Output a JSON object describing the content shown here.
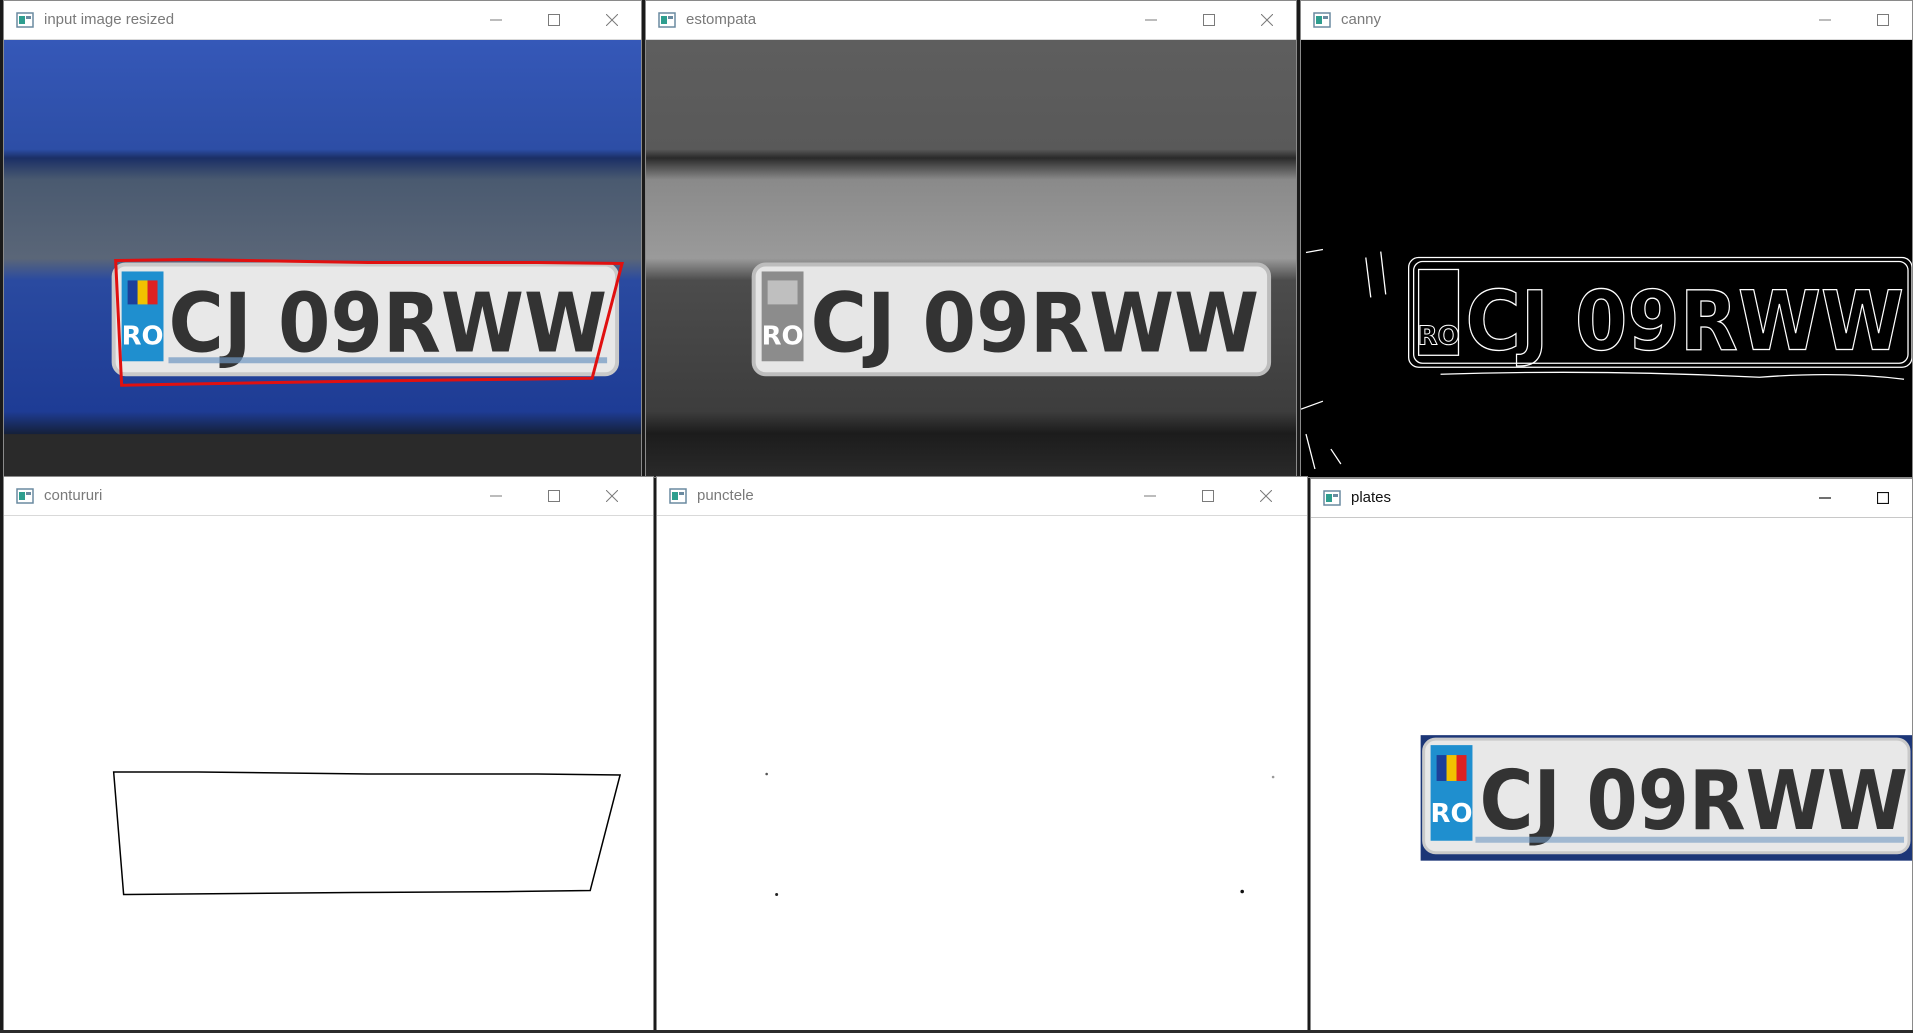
{
  "windows": {
    "w1": {
      "title": "input image resized",
      "plate": "CJ 09RWW",
      "country": "RO"
    },
    "w2": {
      "title": "estompata",
      "plate": "CJ 09RWW",
      "country": "RO"
    },
    "w3": {
      "title": "canny",
      "plate": "CJ 09RWW",
      "country": "RO"
    },
    "w4": {
      "title": "contururi"
    },
    "w5": {
      "title": "punctele"
    },
    "w6": {
      "title": "plates",
      "plate": "CJ 09RWW",
      "country": "RO"
    }
  },
  "icons": {
    "app": "opencv-window-icon",
    "minimize": "minimize-icon",
    "maximize": "maximize-icon",
    "close": "close-icon"
  },
  "colors": {
    "car_blue": "#2a4fa6",
    "highlight_red": "#e01010"
  }
}
